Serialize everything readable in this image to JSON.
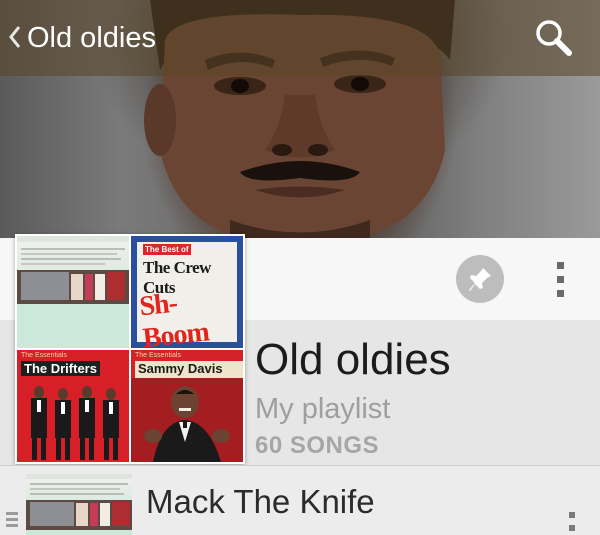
{
  "action_bar": {
    "title": "Old oldies",
    "back_icon": "chevron-left-icon",
    "search_icon": "search-icon"
  },
  "playlist": {
    "title": "Old oldies",
    "type": "My playlist",
    "song_count": "60 SONGS",
    "pin_icon": "pin-icon",
    "menu_icon": "overflow-menu-icon"
  },
  "albums": [
    {
      "label": ""
    },
    {
      "label": "The Crew Cuts",
      "sublabel": "Sh-Boom",
      "badge": "The Best of"
    },
    {
      "series": "The Essentials",
      "artist": "The Drifters"
    },
    {
      "series": "The Essentials",
      "artist": "Sammy Davis Jr."
    }
  ],
  "song_rows": [
    {
      "title": "Mack The Knife"
    }
  ],
  "colors": {
    "accent_blue": "#2a4fa0",
    "album_red": "#d61f26",
    "text_dark": "#1c1c1c",
    "text_muted": "#9e9e9e"
  }
}
